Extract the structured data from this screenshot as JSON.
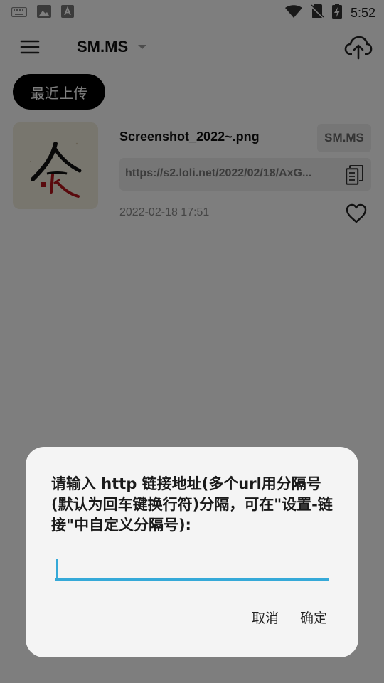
{
  "status_bar": {
    "time": "5:52",
    "left_icons": [
      "keyboard-icon",
      "image-icon",
      "font-icon"
    ],
    "right_icons": [
      "wifi-icon",
      "no-sim-icon",
      "battery-charging-icon"
    ]
  },
  "toolbar": {
    "menu_icon": "menu-icon",
    "title": "SM.MS",
    "upload_icon": "cloud-upload-icon"
  },
  "filter_chip": {
    "label": "最近上传"
  },
  "upload_item": {
    "file_name": "Screenshot_2022~.png",
    "host": "SM.MS",
    "url": "https://s2.loli.net/2022/02/18/AxG...",
    "date": "2022-02-18 17:51",
    "copy_icon": "copy-icon",
    "favorite_icon": "heart-outline-icon",
    "thumbnail_icon": "calligraphy-image-thumbnail"
  },
  "dialog": {
    "message": "请输入 http 链接地址(多个url用分隔号(默认为回车键换行符)分隔，可在\"设置-链接\"中自定义分隔号):",
    "input_value": "",
    "cancel_label": "取消",
    "ok_label": "确定",
    "accent_color": "#35a9d8"
  }
}
